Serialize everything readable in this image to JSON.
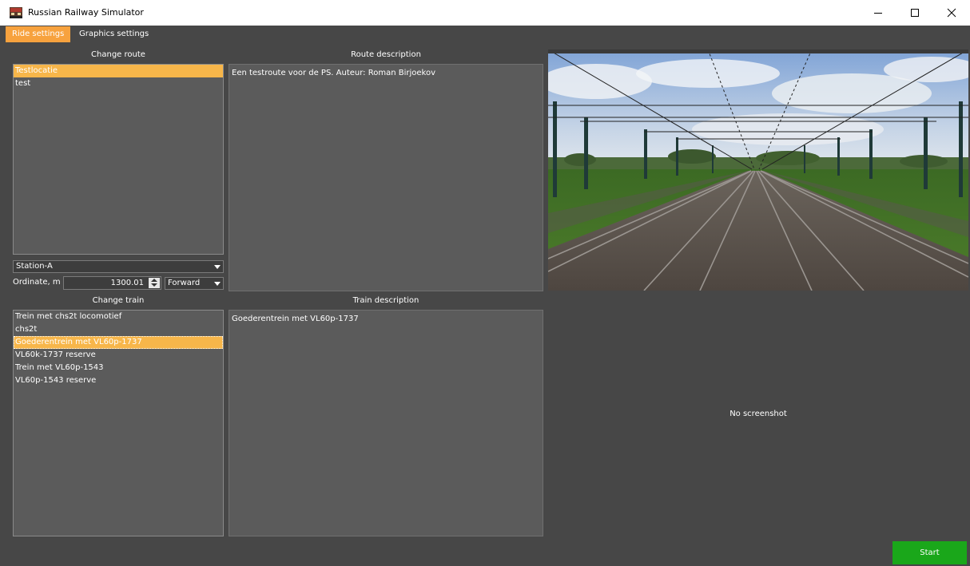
{
  "window": {
    "title": "Russian Railway Simulator",
    "controls": [
      "minimize",
      "maximize",
      "close"
    ]
  },
  "tabs": [
    {
      "label": "Ride settings",
      "active": true
    },
    {
      "label": "Graphics settings",
      "active": false
    }
  ],
  "route": {
    "section_label": "Change route",
    "items": [
      "Testlocatie",
      "test"
    ],
    "selected_index": 0,
    "description_label": "Route description",
    "description": "Een testroute voor de PS. Auteur: Roman Birjoekov",
    "station_select": "Station-A",
    "ordinate_label": "Ordinate, m",
    "ordinate_value": "1300.01",
    "direction_select": "Forward"
  },
  "train": {
    "section_label": "Change train",
    "items": [
      "Trein met chs2t locomotief",
      "chs2t",
      "Goederentrein met VL60p-1737",
      "VL60k-1737 reserve",
      "Trein met VL60p-1543",
      "VL60p-1543 reserve"
    ],
    "selected_index": 2,
    "description_label": "Train description",
    "description": "Goederentrein met VL60p-1737",
    "no_screenshot": "No screenshot"
  },
  "actions": {
    "start_label": "Start"
  },
  "colors": {
    "accent": "#f7a23e",
    "background": "#474747",
    "panel": "#5b5b5b",
    "start_button": "#1aa71a"
  }
}
